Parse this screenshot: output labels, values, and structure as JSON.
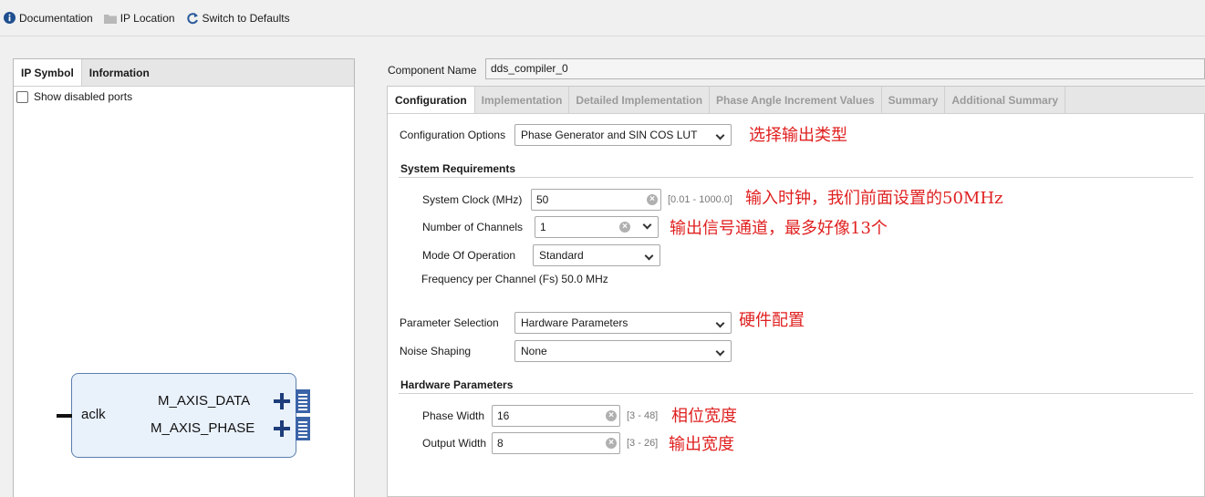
{
  "toolbar": {
    "documentation": "Documentation",
    "ip_location": "IP Location",
    "switch_defaults": "Switch to Defaults"
  },
  "left": {
    "tabs": [
      "IP Symbol",
      "Information"
    ],
    "show_disabled": "Show disabled ports",
    "symbol": {
      "input_port": "aclk",
      "output_ports": [
        "M_AXIS_DATA",
        "M_AXIS_PHASE"
      ]
    }
  },
  "component": {
    "label": "Component Name",
    "value": "dds_compiler_0"
  },
  "tabs": [
    "Configuration",
    "Implementation",
    "Detailed Implementation",
    "Phase Angle Increment Values",
    "Summary",
    "Additional Summary"
  ],
  "config": {
    "options_label": "Configuration Options",
    "options_value": "Phase Generator and SIN COS LUT",
    "sysreq_title": "System Requirements",
    "sysclk_label": "System Clock (MHz)",
    "sysclk_value": "50",
    "sysclk_range": "[0.01 - 1000.0]",
    "channels_label": "Number of Channels",
    "channels_value": "1",
    "mode_label": "Mode Of Operation",
    "mode_value": "Standard",
    "freq_text": "Frequency per Channel (Fs) 50.0 MHz",
    "param_sel_label": "Parameter Selection",
    "param_sel_value": "Hardware Parameters",
    "noise_label": "Noise Shaping",
    "noise_value": "None",
    "hw_title": "Hardware Parameters",
    "phase_width_label": "Phase Width",
    "phase_width_value": "16",
    "phase_width_range": "[3 - 48]",
    "output_width_label": "Output Width",
    "output_width_value": "8",
    "output_width_range": "[3 - 26]"
  },
  "annotations": {
    "config": "选择输出类型",
    "clock": "输入时钟，我们前面设置的50MHz",
    "channels": "输出信号通道，最多好像13个",
    "hardware": "硬件配置",
    "phase": "相位宽度",
    "output": "输出宽度"
  },
  "colors": {
    "annotation": "#e02020",
    "ip_box_fill": "#e9f1fb",
    "ip_box_border": "#5a7fae",
    "bus_blue": "#1e3d7b"
  }
}
